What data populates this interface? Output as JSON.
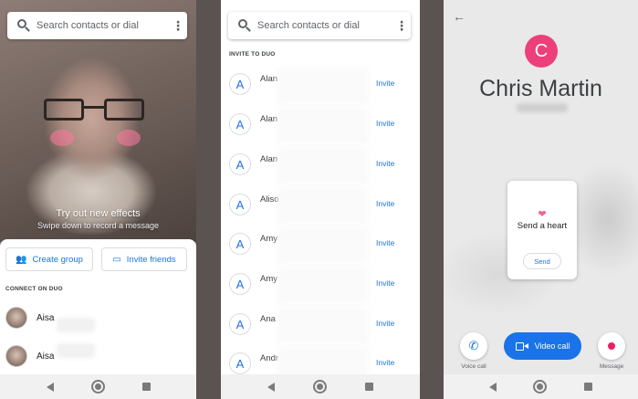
{
  "search": {
    "placeholder": "Search contacts or dial",
    "menu": "⋮"
  },
  "panel1": {
    "effects_title": "Try out new effects",
    "effects_sub": "Swipe down to record a message",
    "create_group": "Create group",
    "invite_friends": "Invite friends",
    "section_label": "CONNECT ON DUO",
    "contacts": [
      {
        "name": "Aisa"
      },
      {
        "name": "Aisa"
      }
    ]
  },
  "panel2": {
    "section_label": "INVITE TO DUO",
    "invite_label": "Invite",
    "contacts": [
      {
        "initial": "A",
        "name": "Alan"
      },
      {
        "initial": "A",
        "name": "Alan"
      },
      {
        "initial": "A",
        "name": "Alan"
      },
      {
        "initial": "A",
        "name": "Aliso"
      },
      {
        "initial": "A",
        "name": "Amy"
      },
      {
        "initial": "A",
        "name": "Amy"
      },
      {
        "initial": "A",
        "name": "Ana ("
      },
      {
        "initial": "A",
        "name": "Andr"
      }
    ]
  },
  "panel3": {
    "back": "←",
    "avatar_initial": "C",
    "contact_name": "Chris Martin",
    "heart_icon": "heart-icon",
    "heart_title": "Send a heart",
    "heart_send": "Send",
    "voice_label": "Voice call",
    "video_label": "Video call",
    "message_label": "Message"
  },
  "colors": {
    "accent": "#1a73e8",
    "avatar_pink": "#ec407a",
    "heart": "#f06292"
  }
}
